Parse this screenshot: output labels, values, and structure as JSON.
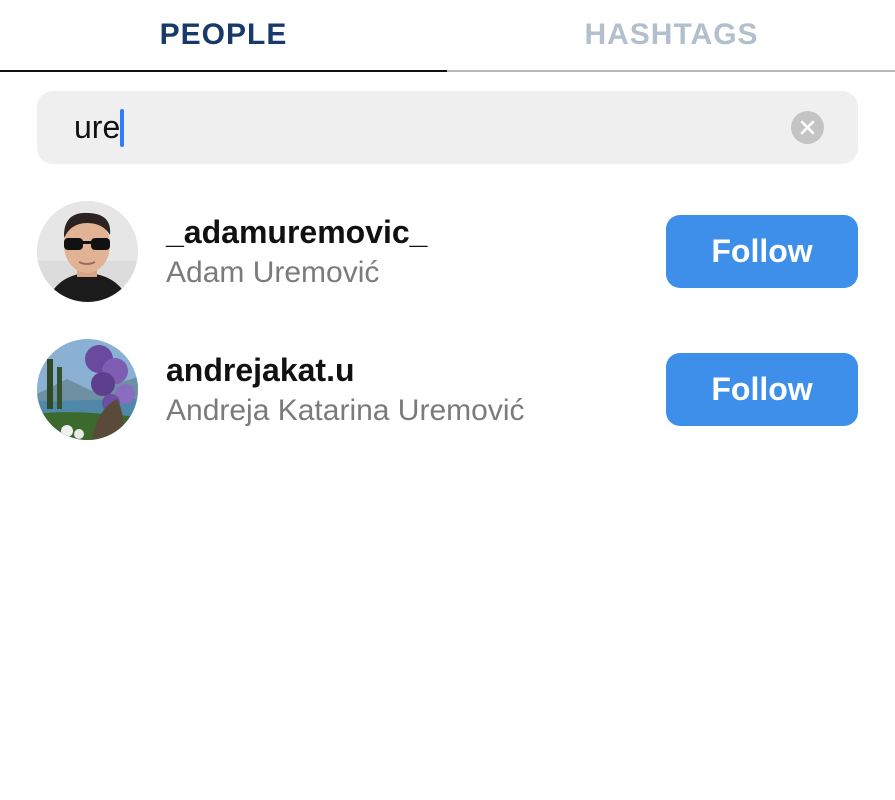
{
  "tabs": [
    {
      "label": "PEOPLE",
      "active": true
    },
    {
      "label": "HASHTAGS",
      "active": false
    }
  ],
  "search": {
    "value": "ure",
    "clear_icon": "clear-icon"
  },
  "results": [
    {
      "username": "_adamuremovic_",
      "full_name": "Adam Uremović",
      "follow_label": "Follow"
    },
    {
      "username": "andrejakat.u",
      "full_name": "Andreja Katarina Uremović",
      "follow_label": "Follow"
    }
  ],
  "colors": {
    "accent": "#3d8fea",
    "active_tab": "#173a6b",
    "inactive_tab": "#b3bfcc",
    "caret": "#2f7cf6"
  }
}
